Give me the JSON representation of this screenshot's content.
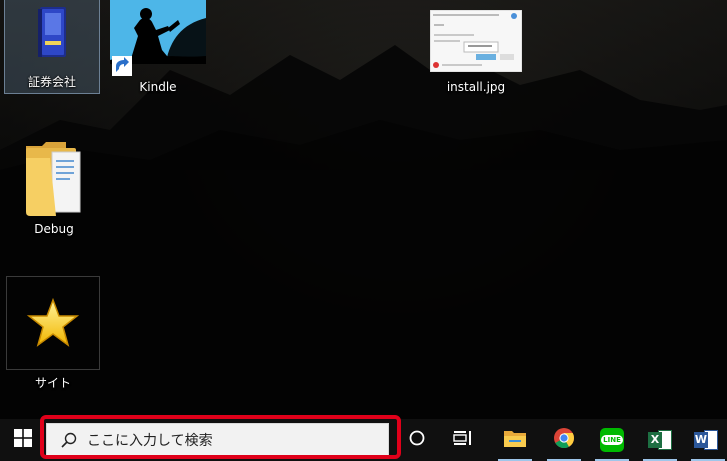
{
  "desktop": {
    "icons": [
      {
        "label": "証券会社",
        "icon": "blue-book-shortcut-icon"
      },
      {
        "label": "Kindle",
        "icon": "kindle-icon"
      },
      {
        "label": "install.jpg",
        "icon": "image-thumbnail-icon"
      },
      {
        "label": "Debug",
        "icon": "folder-icon"
      },
      {
        "label": "サイト",
        "icon": "star-icon"
      }
    ]
  },
  "taskbar": {
    "search_placeholder": "ここに入力して検索",
    "apps": [
      {
        "name": "File Explorer",
        "icon": "file-explorer-icon"
      },
      {
        "name": "Google Chrome",
        "icon": "chrome-icon"
      },
      {
        "name": "LINE",
        "icon": "line-icon",
        "badge": "LINE"
      },
      {
        "name": "Excel",
        "icon": "excel-icon",
        "letter": "X"
      },
      {
        "name": "Word",
        "icon": "word-icon",
        "letter": "W"
      }
    ]
  },
  "colors": {
    "highlight": "#e0001a",
    "taskbar": "#101010",
    "line_green": "#00b900",
    "excel_green": "#1d6f42",
    "word_blue": "#2b579a"
  }
}
